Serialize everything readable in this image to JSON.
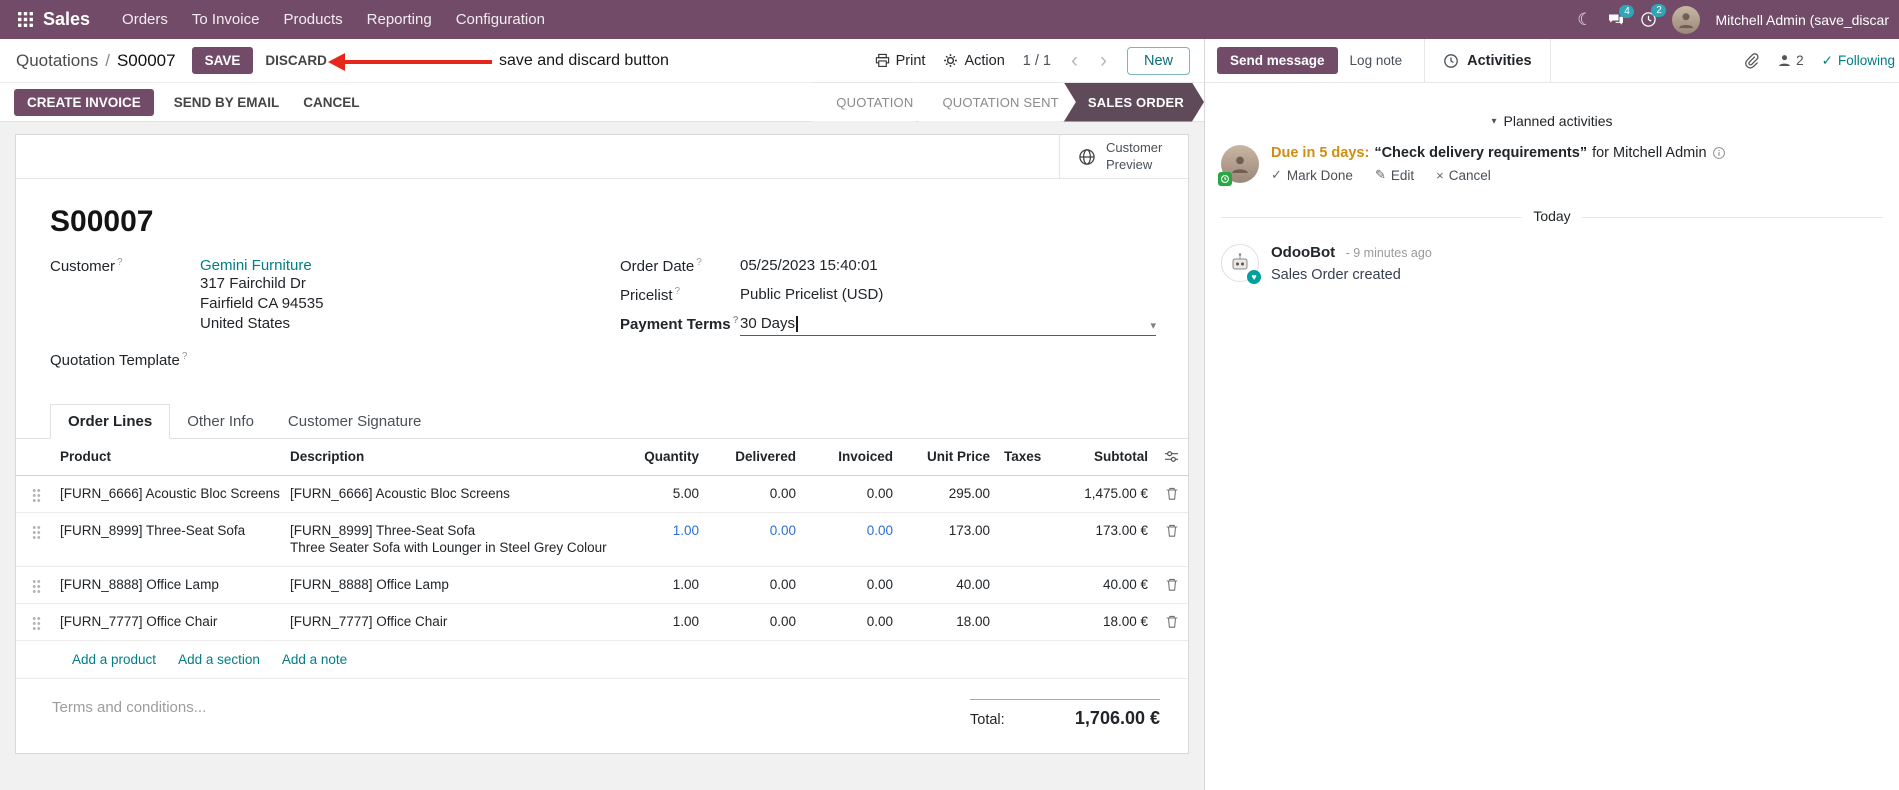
{
  "ui": {
    "help_marker": "?",
    "icons": {
      "moon": "☾",
      "chevron_left": "‹",
      "chevron_right": "›",
      "caret_down": "▾",
      "check": "✓",
      "pencil": "✎",
      "close": "×",
      "heart": "♥"
    },
    "colors": {
      "primary": "#714B67",
      "link_accent": "#017e84",
      "active_state_bg": "#5F4A59",
      "modified_value": "#2E6FD2",
      "due_warning": "#cf8e12",
      "annotation_red": "#e8251a",
      "badge": "#2FA6B5"
    }
  },
  "topbar": {
    "app_name": "Sales",
    "menus": [
      "Orders",
      "To Invoice",
      "Products",
      "Reporting",
      "Configuration"
    ],
    "messages_badge": "4",
    "activities_badge": "2",
    "user_name": "Mitchell Admin (save_discar"
  },
  "control_panel": {
    "breadcrumb_parent": "Quotations",
    "breadcrumb_sep": "/",
    "breadcrumb_current": "S00007",
    "save": "SAVE",
    "discard": "DISCARD",
    "print": "Print",
    "action": "Action",
    "pager": "1 / 1",
    "new": "New"
  },
  "annotation": {
    "label": "save and discard button"
  },
  "statusbar": {
    "actions": [
      "CREATE INVOICE",
      "SEND BY EMAIL",
      "CANCEL"
    ],
    "states": [
      "QUOTATION",
      "QUOTATION SENT",
      "SALES ORDER"
    ],
    "active_state": "SALES ORDER"
  },
  "sheet": {
    "preview_button": "Customer Preview",
    "title": "S00007",
    "fields": {
      "customer": {
        "label": "Customer",
        "value": "Gemini Furniture",
        "address": [
          "317 Fairchild Dr",
          "Fairfield CA 94535",
          "United States"
        ]
      },
      "quotation_template": {
        "label": "Quotation Template"
      },
      "order_date": {
        "label": "Order Date",
        "value": "05/25/2023 15:40:01"
      },
      "pricelist": {
        "label": "Pricelist",
        "value": "Public Pricelist (USD)"
      },
      "payment_terms": {
        "label": "Payment Terms",
        "value": "30 Days"
      }
    },
    "tabs": [
      "Order Lines",
      "Other Info",
      "Customer Signature"
    ],
    "table": {
      "columns": [
        "Product",
        "Description",
        "Quantity",
        "Delivered",
        "Invoiced",
        "Unit Price",
        "Taxes",
        "Subtotal"
      ],
      "rows": [
        {
          "product": "[FURN_6666] Acoustic Bloc Screens",
          "desc": "[FURN_6666] Acoustic Bloc Screens",
          "desc2": "",
          "quantity": "5.00",
          "delivered": "0.00",
          "invoiced": "0.00",
          "unit_price": "295.00",
          "taxes": "",
          "subtotal": "1,475.00 €"
        },
        {
          "product": "[FURN_8999] Three-Seat Sofa",
          "desc": "[FURN_8999] Three-Seat Sofa",
          "desc2": "Three Seater Sofa with Lounger in Steel Grey Colour",
          "quantity": "1.00",
          "delivered": "0.00",
          "invoiced": "0.00",
          "unit_price": "173.00",
          "taxes": "",
          "subtotal": "173.00 €"
        },
        {
          "product": "[FURN_8888] Office Lamp",
          "desc": "[FURN_8888] Office Lamp",
          "desc2": "",
          "quantity": "1.00",
          "delivered": "0.00",
          "invoiced": "0.00",
          "unit_price": "40.00",
          "taxes": "",
          "subtotal": "40.00 €"
        },
        {
          "product": "[FURN_7777] Office Chair",
          "desc": "[FURN_7777] Office Chair",
          "desc2": "",
          "quantity": "1.00",
          "delivered": "0.00",
          "invoiced": "0.00",
          "unit_price": "18.00",
          "taxes": "",
          "subtotal": "18.00 €"
        }
      ],
      "add_product": "Add a product",
      "add_section": "Add a section",
      "add_note": "Add a note"
    },
    "terms_placeholder": "Terms and conditions...",
    "total_label": "Total:",
    "total_value": "1,706.00 €"
  },
  "chatter": {
    "send_message": "Send message",
    "log_note": "Log note",
    "activities": "Activities",
    "followers_count": "2",
    "following": "Following",
    "planned_title": "Planned activities",
    "activity": {
      "due": "Due in 5 days:",
      "summary": "“Check delivery requirements”",
      "assignee": "for Mitchell Admin",
      "mark_done": "Mark Done",
      "edit": "Edit",
      "cancel": "Cancel"
    },
    "today": "Today",
    "message": {
      "author": "OdooBot",
      "time": "- 9 minutes ago",
      "body": "Sales Order created"
    }
  }
}
